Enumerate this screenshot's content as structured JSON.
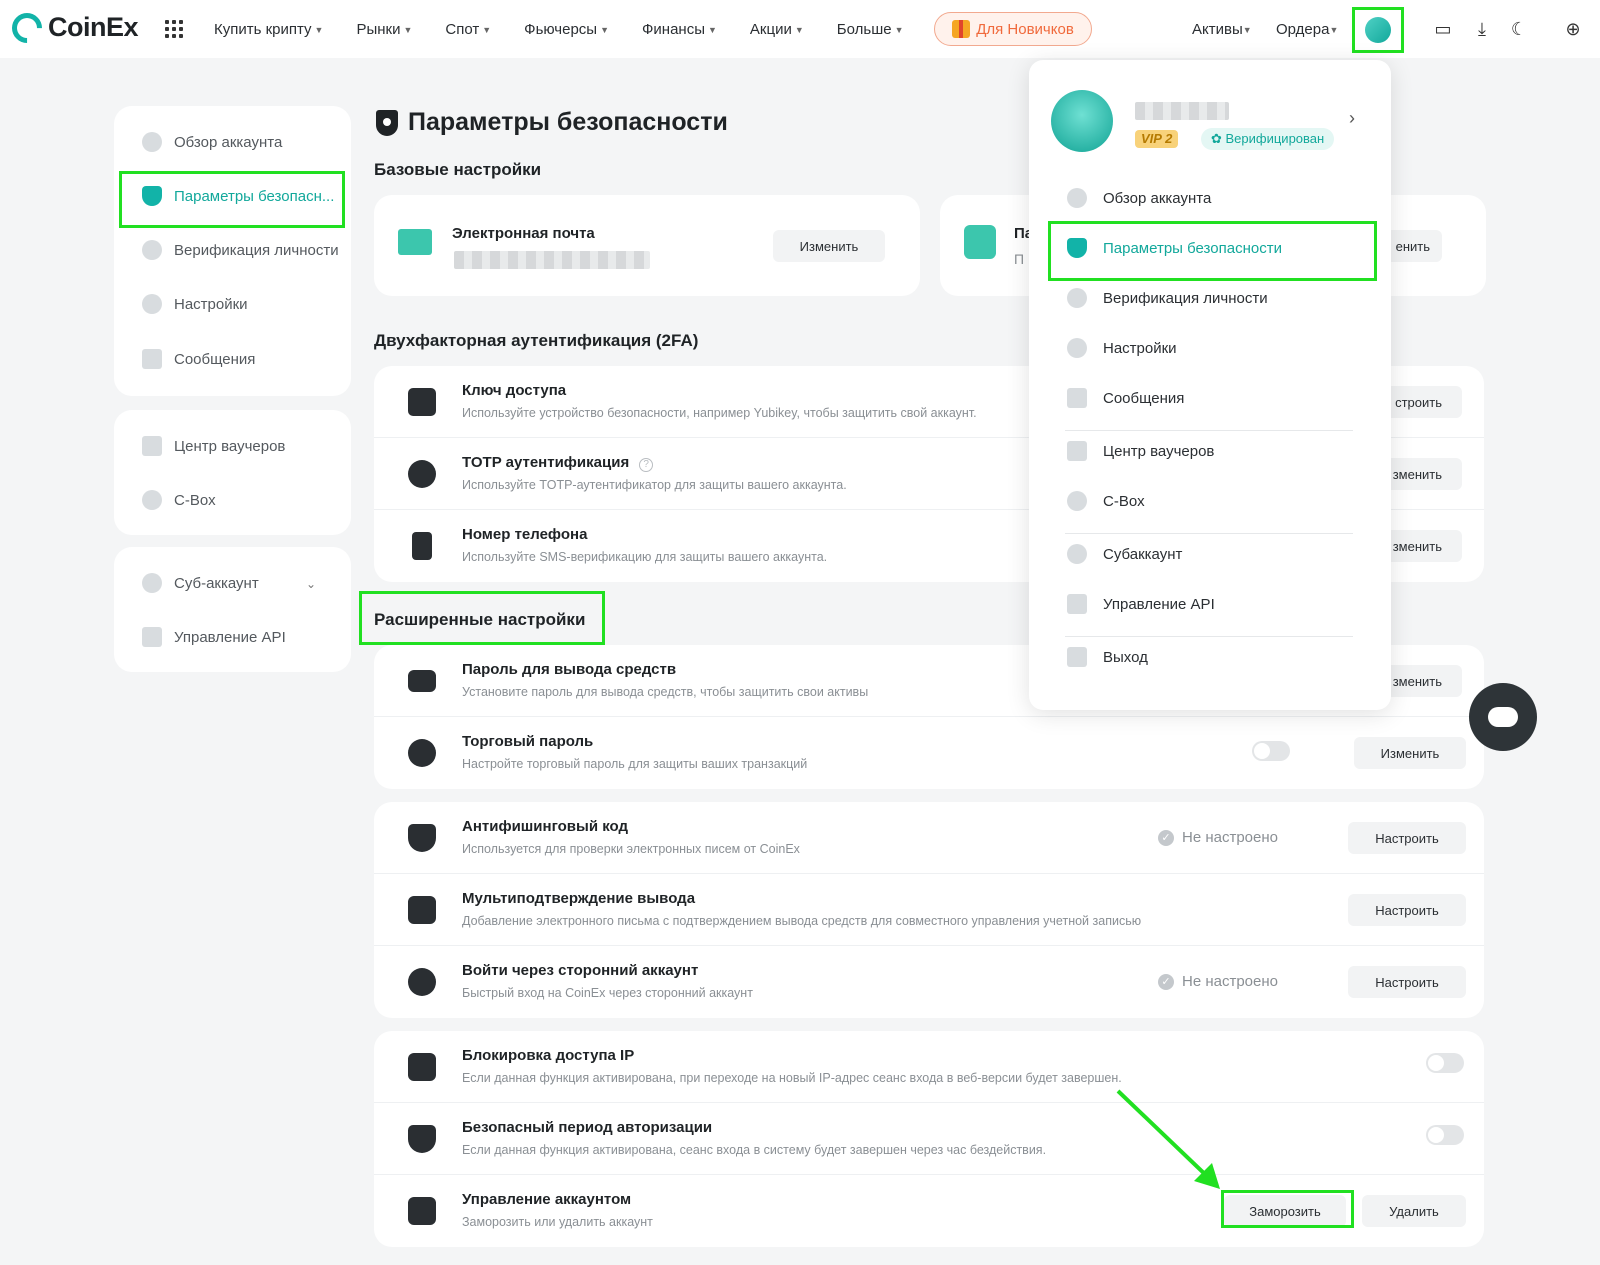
{
  "header": {
    "logo_text": "CoinEx",
    "menu": [
      {
        "label": "Купить крипту"
      },
      {
        "label": "Рынки"
      },
      {
        "label": "Спот"
      },
      {
        "label": "Фьючерсы"
      },
      {
        "label": "Финансы"
      },
      {
        "label": "Акции"
      },
      {
        "label": "Больше"
      }
    ],
    "promo_label": "Для Новичков",
    "assets_label": "Активы",
    "orders_label": "Ордера"
  },
  "sidebar": {
    "group1": [
      {
        "label": "Обзор аккаунта",
        "icon": "pie-icon"
      },
      {
        "label": "Параметры безопасн...",
        "icon": "shield-icon",
        "active": true
      },
      {
        "label": "Верификация личности",
        "icon": "id-icon"
      },
      {
        "label": "Настройки",
        "icon": "settings-icon"
      },
      {
        "label": "Сообщения",
        "icon": "message-icon"
      }
    ],
    "group2": [
      {
        "label": "Центр ваучеров",
        "icon": "voucher-icon"
      },
      {
        "label": "C-Box",
        "icon": "box-icon"
      }
    ],
    "group3": [
      {
        "label": "Суб-аккаунт",
        "icon": "subaccount-icon"
      },
      {
        "label": "Управление API",
        "icon": "api-icon"
      }
    ]
  },
  "main": {
    "title": "Параметры безопасности",
    "basic_heading": "Базовые настройки",
    "email": {
      "title": "Электронная почта",
      "button": "Изменить"
    },
    "password_card": {
      "title_partial": "Па",
      "desc_partial": "П",
      "button_partial": "енить"
    },
    "twofa_heading": "Двухфакторная аутентификация (2FA)",
    "twofa_rows": [
      {
        "title": "Ключ доступа",
        "desc": "Используйте устройство безопасности, например Yubikey, чтобы защитить свой аккаунт.",
        "button": "строить"
      },
      {
        "title": "TOTP аутентификация",
        "desc": "Используйте TOTP-аутентификатор для защиты вашего аккаунта.",
        "button": "зменить"
      },
      {
        "title": "Номер телефона",
        "desc": "Используйте SMS-верификацию для защиты вашего аккаунта.",
        "button": "зменить"
      }
    ],
    "advanced_heading": "Расширенные настройки",
    "adv_rows_1": [
      {
        "title": "Пароль для вывода средств",
        "desc": "Установите пароль для вывода средств, чтобы защитить свои активы",
        "button": "зменить"
      },
      {
        "title": "Торговый пароль",
        "desc": "Настройте торговый пароль для защиты ваших транзакций",
        "button": "Изменить"
      }
    ],
    "adv_rows_2": [
      {
        "title": "Антифишинговый код",
        "desc": "Используется для проверки электронных писем от CoinEx",
        "status": "Не настроено",
        "button": "Настроить"
      },
      {
        "title": "Мультиподтверждение вывода",
        "desc": "Добавление электронного письма с подтверждением вывода средств для совместного управления учетной записью",
        "button": "Настроить"
      },
      {
        "title": "Войти через сторонний аккаунт",
        "desc": "Быстрый вход на CoinEx через сторонний аккаунт",
        "status": "Не настроено",
        "button": "Настроить"
      }
    ],
    "adv_rows_3": [
      {
        "title": "Блокировка доступа IP",
        "desc": "Если данная функция активирована, при переходе на новый IP-адрес сеанс входа в веб-версии будет завершен."
      },
      {
        "title": "Безопасный период авторизации",
        "desc": "Если данная функция активирована, сеанс входа в систему будет завершен через час бездействия."
      },
      {
        "title": "Управление аккаунтом",
        "desc": "Заморозить или удалить аккаунт",
        "freeze_button": "Заморозить",
        "delete_button": "Удалить"
      }
    ]
  },
  "dropdown": {
    "vip": "VIP 2",
    "verified": "Верифицирован",
    "items": [
      {
        "label": "Обзор аккаунта"
      },
      {
        "label": "Параметры безопасности",
        "active": true
      },
      {
        "label": "Верификация личности"
      },
      {
        "label": "Настройки"
      },
      {
        "label": "Сообщения"
      },
      {
        "label": "Центр ваучеров"
      },
      {
        "label": "C-Box"
      },
      {
        "label": "Субаккаунт"
      },
      {
        "label": "Управление API"
      },
      {
        "label": "Выход"
      }
    ]
  },
  "colors": {
    "accent": "#12b3a8",
    "highlight": "#21e021"
  }
}
